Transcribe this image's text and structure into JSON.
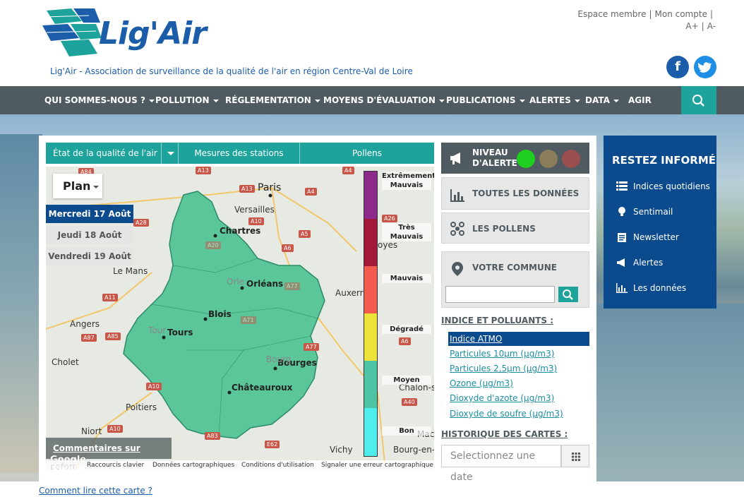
{
  "header": {
    "logo_text": "Lig'Air",
    "tagline": "Lig'Air - Association de surveillance de la qualité de l'air en région Centre-Val de Loire",
    "top_links": [
      "Espace membre",
      "Mon compte"
    ],
    "font_controls": [
      "A+",
      "A-"
    ],
    "social": {
      "facebook": "f",
      "twitter": "t"
    }
  },
  "nav": {
    "items": [
      {
        "label": "QUI SOMMES-NOUS ?",
        "dropdown": true
      },
      {
        "label": "POLLUTION",
        "dropdown": true
      },
      {
        "label": "RÉGLEMENTATION",
        "dropdown": true
      },
      {
        "label": "MOYENS D'ÉVALUATION",
        "dropdown": true
      },
      {
        "label": "PUBLICATIONS",
        "dropdown": true
      },
      {
        "label": "ALERTES",
        "dropdown": true
      },
      {
        "label": "DATA",
        "dropdown": true
      },
      {
        "label": "AGIR",
        "dropdown": false
      }
    ],
    "search_icon": "search-icon"
  },
  "map_tabs": {
    "tab1": "État de la qualité de l'air",
    "tab2": "Mesures des stations",
    "tab3": "Pollens"
  },
  "map": {
    "plan_label": "Plan",
    "days": [
      {
        "label": "Mercredi 17 Août",
        "active": true
      },
      {
        "label": "Jeudi 18 Août",
        "active": false
      },
      {
        "label": "Vendredi 19 Août",
        "active": false
      }
    ],
    "cities": [
      "Paris",
      "Versailles",
      "Chartres",
      "Orléans",
      "Blois",
      "Tours",
      "Bourges",
      "Châteauroux",
      "Le Mans",
      "Angers",
      "Cholet",
      "Poitiers",
      "Niort",
      "Auxerre",
      "Vichy",
      "Chalon-sur-",
      "Bourg-en-Bre",
      "Mac",
      "Orle",
      "Tour",
      "Bourg",
      "oyes"
    ],
    "roads": [
      "A84",
      "A13",
      "A4",
      "A13",
      "A4",
      "A10",
      "A5",
      "A26",
      "A6",
      "A28",
      "A11",
      "A85",
      "A87",
      "A10",
      "A10",
      "A83",
      "A77",
      "A6",
      "A40",
      "E62",
      "A20",
      "A71",
      "A77"
    ],
    "legend": [
      "Extrêmement Mauvais",
      "Très Mauvais",
      "Mauvais",
      "Dégradé",
      "Moyen",
      "Bon"
    ],
    "legend_colors": [
      "#8b2a8a",
      "#a3173a",
      "#f35a50",
      "#eee33a",
      "#4ec4a4",
      "#50eded"
    ],
    "comment_link": "Commentaires sur l'indice",
    "footer": [
      "Raccourcis clavier",
      "Données cartographiques",
      "Conditions d'utilisation",
      "Signaler une erreur cartographique"
    ],
    "google": "Google",
    "region_color": "#5ac69a",
    "partial_labels": [
      "pefort"
    ]
  },
  "alert": {
    "label_line1": "NIVEAU",
    "label_line2": "D'ALERTE",
    "dot_colors": [
      "#1fcf1f",
      "#8a7d59",
      "#9a4e4e"
    ]
  },
  "side": {
    "all_data": "TOUTES LES DONNÉES",
    "pollens": "LES POLLENS",
    "commune": "VOTRE COMMUNE"
  },
  "indices": {
    "title": "INDICE ET POLLUANTS :",
    "items": [
      {
        "label": "Indice ATMO",
        "active": true
      },
      {
        "label": "Particules 10µm (µg/m3)",
        "active": false
      },
      {
        "label": "Particules 2,5µm (µg/m3)",
        "active": false
      },
      {
        "label": "Ozone (µg/m3)",
        "active": false
      },
      {
        "label": "Dioxyde d'azote (µg/m3)",
        "active": false
      },
      {
        "label": "Dioxyde de soufre (µg/m3)",
        "active": false
      }
    ]
  },
  "history": {
    "title": "HISTORIQUE DES CARTES :",
    "placeholder": "Selectionnez une date"
  },
  "info": {
    "title": "RESTEZ INFORMÉ",
    "items": [
      "Indices quotidiens",
      "Sentimail",
      "Newsletter",
      "Alertes",
      "Les données"
    ]
  },
  "footer_link": "Comment lire cette carte ?"
}
